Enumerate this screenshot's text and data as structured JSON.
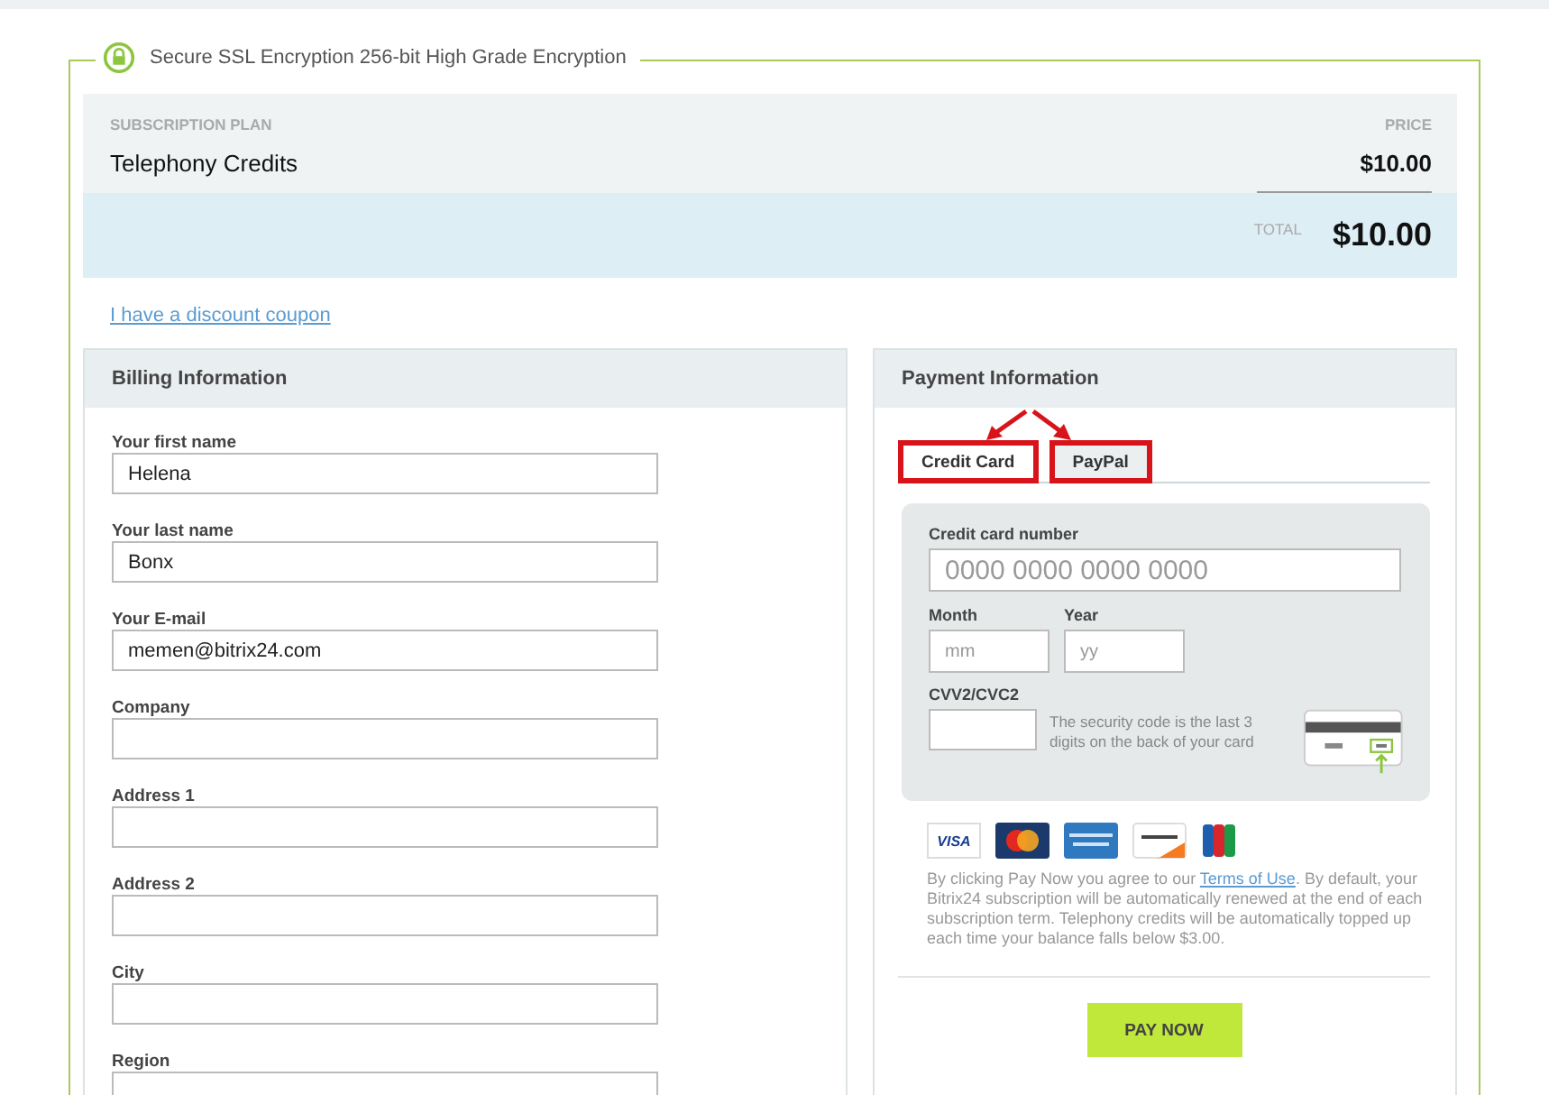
{
  "security_banner": {
    "text": "Secure SSL Encryption 256-bit High Grade Encryption"
  },
  "order_summary": {
    "plan_heading": "SUBSCRIPTION PLAN",
    "plan_name": "Telephony Credits",
    "price_heading": "PRICE",
    "price": "$10.00",
    "total_heading": "TOTAL",
    "total": "$10.00"
  },
  "discount_link": "I have a discount coupon",
  "billing": {
    "title": "Billing Information",
    "fields": [
      {
        "label": "Your first name",
        "value": "Helena"
      },
      {
        "label": "Your last name",
        "value": "Bonx"
      },
      {
        "label": "Your E-mail",
        "value": "memen@bitrix24.com"
      },
      {
        "label": "Company"
      },
      {
        "label": "Address 1"
      },
      {
        "label": "Address 2"
      },
      {
        "label": "City"
      },
      {
        "label": "Region"
      }
    ]
  },
  "payment": {
    "title": "Payment Information",
    "tabs": [
      {
        "label": "Credit Card",
        "selected": true,
        "highlighted": true
      },
      {
        "label": "PayPal",
        "selected": false,
        "highlighted": true
      }
    ],
    "card_form": {
      "number_label": "Credit card number",
      "number_placeholder": "0000 0000 0000 0000",
      "month_label": "Month",
      "month_placeholder": "mm",
      "year_label": "Year",
      "year_placeholder": "yy",
      "cvv_label": "CVV2/CVC2",
      "cvv_hint": "The security code is the last 3 digits on the back of your card"
    },
    "card_logos": [
      {
        "kind": "visa",
        "label": "VISA"
      },
      {
        "kind": "mastercard"
      },
      {
        "kind": "amex"
      },
      {
        "kind": "discover"
      },
      {
        "kind": "jcb"
      }
    ],
    "terms": {
      "before": "By clicking Pay Now you agree to our ",
      "link": "Terms of Use",
      "after": ". By default, your Bitrix24 subscription will be automatically renewed at the end of each subscription term. Telephony credits will be automatically topped up each time your balance falls below $3.00."
    },
    "pay_button": "PAY NOW"
  }
}
